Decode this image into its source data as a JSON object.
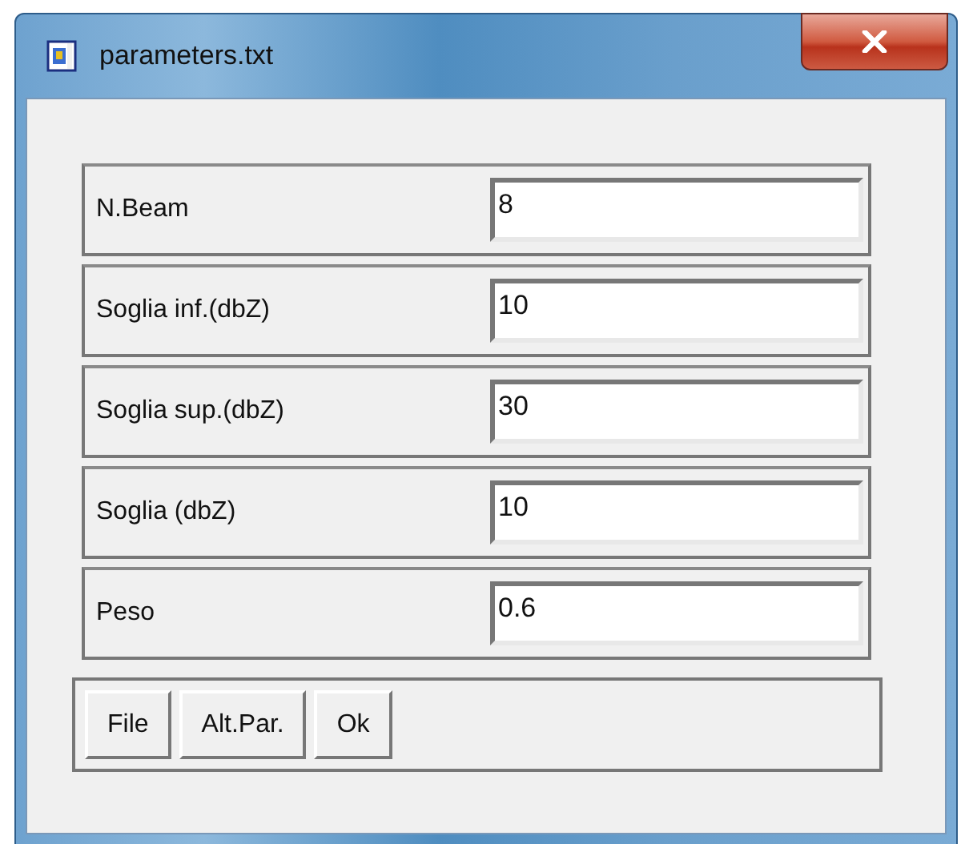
{
  "window": {
    "title": "parameters.txt"
  },
  "fields": [
    {
      "label": "N.Beam",
      "value": "8"
    },
    {
      "label": "Soglia inf.(dbZ)",
      "value": "10"
    },
    {
      "label": "Soglia sup.(dbZ)",
      "value": "30"
    },
    {
      "label": "Soglia (dbZ)",
      "value": "10"
    },
    {
      "label": "Peso",
      "value": "0.6"
    }
  ],
  "buttons": [
    "File",
    "Alt.Par.",
    "Ok"
  ]
}
